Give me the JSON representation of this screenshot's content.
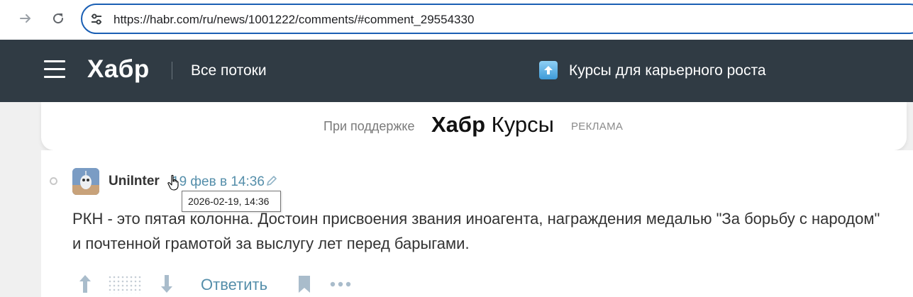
{
  "browser": {
    "url": "https://habr.com/ru/news/1001222/comments/#comment_29554330"
  },
  "header": {
    "logo": "Хабр",
    "all_flows": "Все потоки",
    "promo_label": "Курсы для карьерного роста",
    "bg_color": "#303b44"
  },
  "sponsor": {
    "prefix": "При поддержке",
    "brand_bold": "Хабр",
    "brand_regular": "Курсы",
    "ad_label": "РЕКЛАМА"
  },
  "comment": {
    "username": "UniInter",
    "timestamp": "19 фев в 14:36",
    "tooltip": "2026-02-19, 14:36",
    "text": "РКН - это пятая колонна. Достоин присвоения звания иноагента, награждения медалью \"За борьбу с народом\" и почтенной грамотой за выслугу лет перед барыгами.",
    "reply_label": "Ответить",
    "link_color": "#548eaa"
  },
  "icons": [
    "forward-icon",
    "reload-icon",
    "site-info-icon",
    "menu-icon",
    "promo-arrow-icon",
    "edit-icon",
    "vote-up-icon",
    "vote-down-icon",
    "bookmark-icon",
    "more-icon",
    "cursor-icon"
  ]
}
